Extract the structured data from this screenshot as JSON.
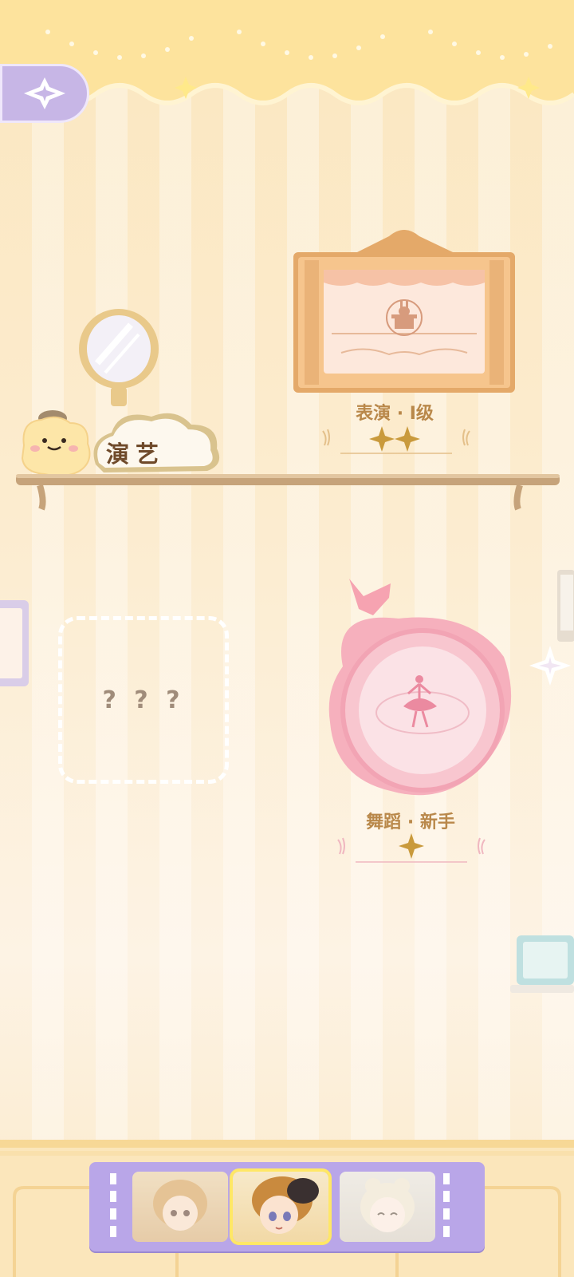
{
  "header": {
    "back_icon": "four-point-star-icon"
  },
  "shelf": {
    "category_label": "演艺"
  },
  "items": [
    {
      "name": "表演 · Ⅰ级",
      "stars": 2,
      "icon": "rabbit-in-hat-icon"
    },
    {
      "name": "舞蹈 · 新手",
      "stars": 1,
      "icon": "ballerina-icon"
    },
    {
      "name": "? ? ?",
      "locked": true
    }
  ],
  "navigation": {
    "next_icon": "four-point-star-arrow-icon"
  },
  "characters": {
    "slots": [
      {
        "id": "char-1",
        "selected": false
      },
      {
        "id": "char-2",
        "selected": true
      },
      {
        "id": "char-3",
        "selected": false
      }
    ]
  },
  "colors": {
    "accent": "#c7b6e6",
    "label": "#b9884a",
    "selected_outline": "#ffe766"
  }
}
